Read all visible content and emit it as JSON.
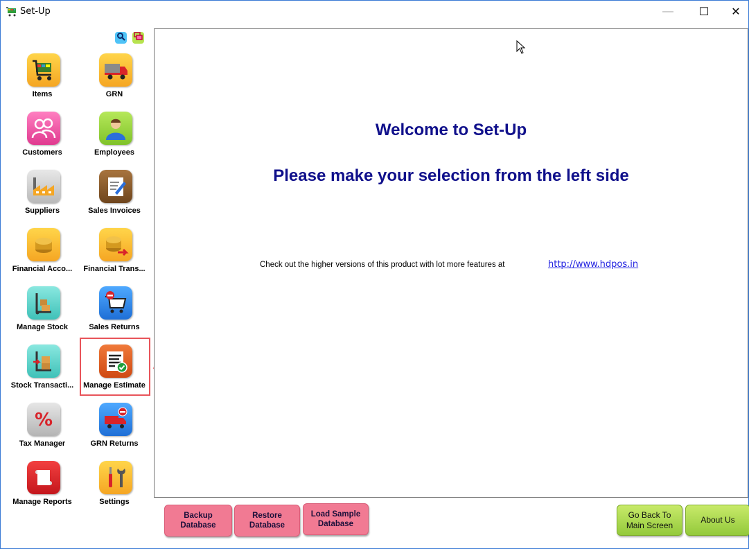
{
  "window": {
    "title": "Set-Up",
    "minimize_glyph": "—",
    "maximize_glyph": "☐",
    "close_glyph": "✕"
  },
  "toolbar": {
    "search_icon": "search-icon",
    "windows_icon": "windows-icon"
  },
  "sidebar": {
    "items": [
      {
        "label": "Items",
        "icon": "shopping-cart-icon"
      },
      {
        "label": "GRN",
        "icon": "delivery-truck-icon"
      },
      {
        "label": "Customers",
        "icon": "people-icon"
      },
      {
        "label": "Employees",
        "icon": "person-icon"
      },
      {
        "label": "Suppliers",
        "icon": "factory-icon"
      },
      {
        "label": "Sales Invoices",
        "icon": "edit-document-icon"
      },
      {
        "label": "Financial Acco...",
        "icon": "coins-icon"
      },
      {
        "label": "Financial Trans...",
        "icon": "coins-transfer-icon"
      },
      {
        "label": "Manage Stock",
        "icon": "hand-truck-icon"
      },
      {
        "label": "Sales Returns",
        "icon": "cart-remove-icon"
      },
      {
        "label": "Stock Transacti...",
        "icon": "stock-transfer-icon"
      },
      {
        "label": "Manage Estimate",
        "icon": "estimate-check-icon"
      },
      {
        "label": "Tax Manager",
        "icon": "percent-icon"
      },
      {
        "label": "GRN Returns",
        "icon": "truck-remove-icon"
      },
      {
        "label": "Manage Reports",
        "icon": "report-scroll-icon"
      },
      {
        "label": "Settings",
        "icon": "tools-icon"
      }
    ]
  },
  "main": {
    "welcome": "Welcome to Set-Up",
    "instruction": "Please make your selection from the left side",
    "promo_text": "Check out the higher versions of this product with lot more features at",
    "promo_link": "http://www.hdpos.in"
  },
  "footer": {
    "backup": "Backup\nDatabase",
    "restore": "Restore\nDatabase",
    "load_sample": "Load Sample\nDatabase",
    "go_back": "Go Back To\nMain Screen",
    "about": "About Us"
  },
  "colors": {
    "heading": "#10108b",
    "link": "#1f1fe0",
    "pink_button": "#f17a93",
    "green_button": "#a8d64a",
    "highlight": "#e8545a"
  }
}
